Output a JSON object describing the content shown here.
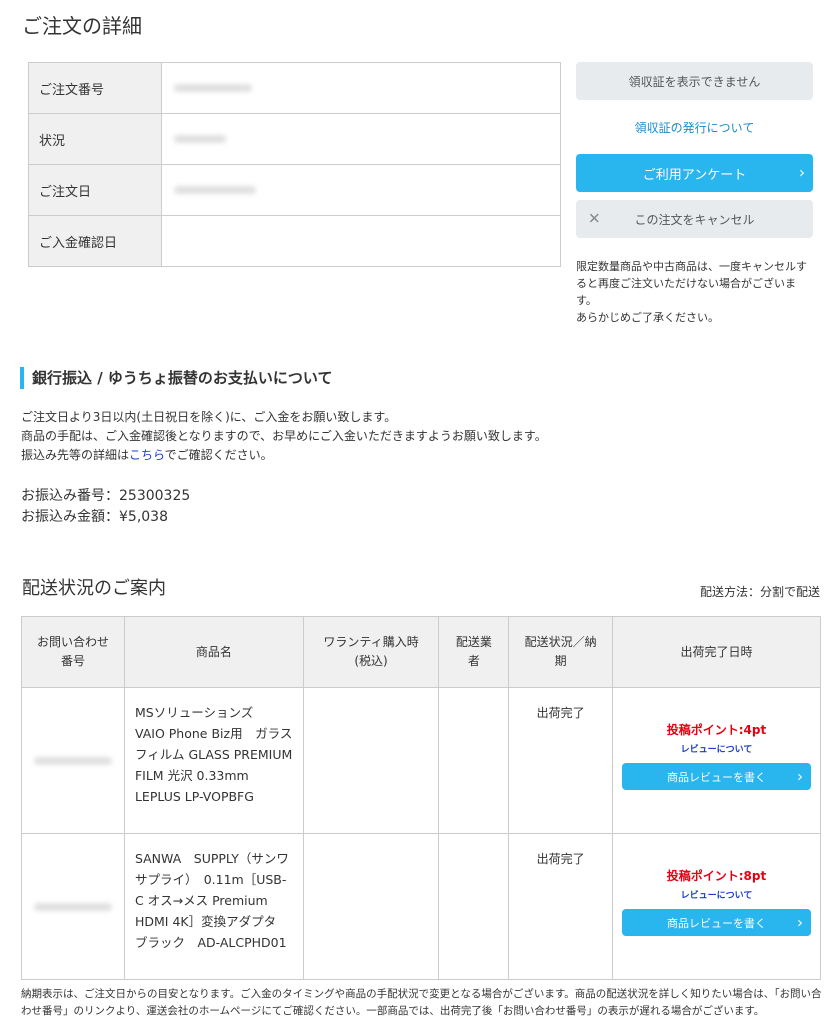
{
  "page_title": "ご注文の詳細",
  "order_info": {
    "rows": [
      {
        "label": "ご注文番号",
        "blurred": true
      },
      {
        "label": "状況",
        "blurred": true
      },
      {
        "label": "ご注文日",
        "blurred": true
      },
      {
        "label": "ご入金確認日",
        "blurred": false
      }
    ]
  },
  "actions": {
    "receipt_button": "領収証を表示できません",
    "receipt_link": "領収証の発行について",
    "survey_button": "ご利用アンケート",
    "cancel_button": "この注文をキャンセル",
    "cancel_note": "限定数量商品や中古商品は、一度キャンセルすると再度ご注文いただけない場合がございます。\nあらかじめご了承ください。"
  },
  "bank": {
    "heading": "銀行振込 / ゆうちょ振替のお支払いについて",
    "line1": "ご注文日より3日以内(土日祝日を除く)に、ご入金をお願い致します。",
    "line2": "商品の手配は、ご入金確認後となりますので、お早めにご入金いただきますようお願い致します。",
    "line3_before": "振込み先等の詳細は",
    "line3_link": "こちら",
    "line3_after": "でご確認ください。",
    "transfer_number": "お振込み番号：25300325",
    "transfer_amount": "お振込み金額：¥5,038"
  },
  "delivery": {
    "title": "配送状況のご案内",
    "method": "配送方法：分割で配送",
    "headers": [
      "お問い合わせ\n番号",
      "商品名",
      "ワランティ購入時\n(税込)",
      "配送業\n者",
      "配送状況／納\n期",
      "出荷完了日時"
    ],
    "items": [
      {
        "name": "MSソリューションズ　VAIO Phone Biz用　ガラスフィルム GLASS PREMIUM FILM 光沢 0.33mm　LEPLUS LP-VOPBFG",
        "status": "出荷完了",
        "points": "投稿ポイント:4pt",
        "review_link": "レビューについて",
        "review_button": "商品レビューを書く"
      },
      {
        "name": "SANWA　SUPPLY（サンワサプライ）　0.11m［USB-C オス→メス Premium HDMI 4K］変換アダプタ　ブラック　AD-ALCPHD01",
        "status": "出荷完了",
        "points": "投稿ポイント:8pt",
        "review_link": "レビューについて",
        "review_button": "商品レビューを書く"
      }
    ]
  },
  "footer_note": "納期表示は、ご注文日からの目安となります。ご入金のタイミングや商品の手配状況で変更となる場合がございます。商品の配送状況を詳しく知りたい場合は、「お問い合わせ番号」のリンクより、運送会社のホームページにてご確認ください。一部商品では、出荷完了後「お問い合わせ番号」の表示が遅れる場合がございます。",
  "colors": {
    "accent": "#29b6ee",
    "point_red": "#e60012",
    "link_blue": "#1a8cc8"
  }
}
